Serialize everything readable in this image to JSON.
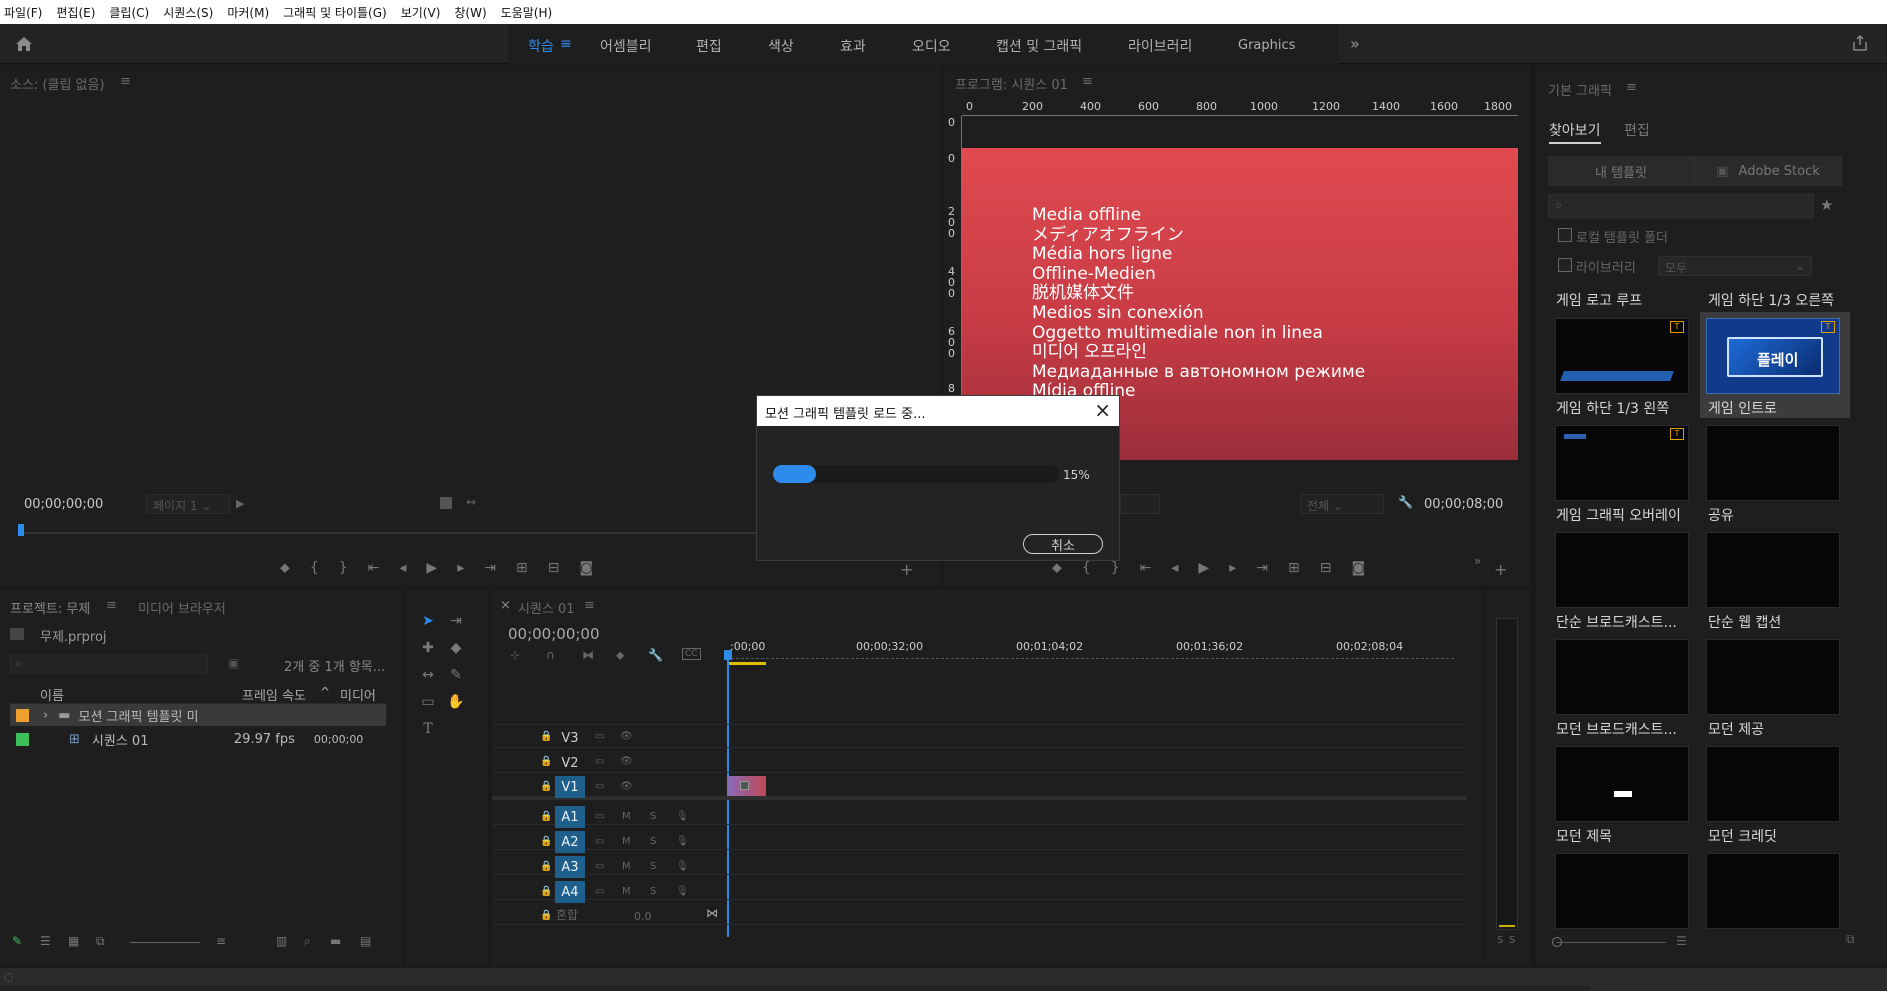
{
  "menu": [
    "파일(F)",
    "편집(E)",
    "클립(C)",
    "시퀀스(S)",
    "마커(M)",
    "그래픽 및 타이틀(G)",
    "보기(V)",
    "창(W)",
    "도움말(H)"
  ],
  "workspaces": {
    "tabs": [
      "학습",
      "어셈블리",
      "편집",
      "색상",
      "효과",
      "오디오",
      "캡션 및 그래픽",
      "라이브러리",
      "Graphics"
    ],
    "active": "학습",
    "more": "»"
  },
  "source_monitor": {
    "title": "소스: (클립 없음)",
    "menu_glyph": "≡",
    "timecode": "00;00;00;00",
    "page": "페이지 1"
  },
  "program_monitor": {
    "title": "프로그램: 시퀀스 01",
    "menu_glyph": "≡",
    "fit": "전체",
    "timecode": "00;00;08;00",
    "ruler_labels": [
      "0",
      "200",
      "400",
      "600",
      "800",
      "1000",
      "1200",
      "1400",
      "1600",
      "1800"
    ],
    "vruler_labels": [
      "0",
      "0",
      "2 0 0",
      "4 0 0",
      "6 0 0",
      "8"
    ],
    "offline_lines": [
      "Media offline",
      "メディアオフライン",
      "Média hors ligne",
      "Offline-Medien",
      "脱机媒体文件",
      "Medios sin conexión",
      "Oggetto multimediale non in linea",
      "미디어 오프라인",
      "Медиаданные в автономном режиме",
      "Mídia offline"
    ]
  },
  "essential_graphics": {
    "title": "기본 그래픽",
    "menu_glyph": "≡",
    "tabs": [
      "찾아보기",
      "편집"
    ],
    "active_tab": "찾아보기",
    "my_templates": "내 템플릿",
    "adobe_stock": "Adobe Stock",
    "local_folder": "로컬 템플릿 폴더",
    "libraries": "라이브러리",
    "library_select": "모두",
    "templates": [
      {
        "label": "게임 로고 루프",
        "thumb_label": "게임 하단 1/3 왼쪽"
      },
      {
        "label": "게임 하단 1/3 오른쪽",
        "thumb_label": "게임 인트로"
      },
      {
        "label": "",
        "thumb_label": "게임 그래픽 오버레이"
      },
      {
        "label": "",
        "thumb_label": "공유"
      },
      {
        "label": "",
        "thumb_label": "단순 브로드캐스트..."
      },
      {
        "label": "",
        "thumb_label": "단순 웹 캡션"
      },
      {
        "label": "",
        "thumb_label": "모던 브로드캐스트..."
      },
      {
        "label": "",
        "thumb_label": "모던 제공"
      },
      {
        "label": "",
        "thumb_label": "모던 제목"
      },
      {
        "label": "",
        "thumb_label": "모던 크레딧"
      }
    ],
    "intro_thumb_text": "플레이"
  },
  "project": {
    "title": "프로젝트: 무제",
    "menu_glyph": "≡",
    "media_browser": "미디어 브라우저",
    "file": "무제.prproj",
    "count": "2개 중 1개 항목...",
    "columns": [
      "이름",
      "프레임 속도",
      "미디어"
    ],
    "rows": [
      {
        "name": "모션 그래픽 템플릿 미",
        "fps": "",
        "media": ""
      },
      {
        "name": "시퀀스 01",
        "fps": "29.97 fps",
        "media": "00;00;00"
      }
    ]
  },
  "timeline": {
    "title": "시퀀스 01",
    "menu_glyph": "≡",
    "timecode": "00;00;00;00",
    "ruler": [
      ":00;00",
      "00;00;32;00",
      "00;01;04;02",
      "00;01;36;02",
      "00;02;08;04"
    ],
    "video_tracks": [
      "V3",
      "V2",
      "V1"
    ],
    "audio_tracks": [
      "A1",
      "A2",
      "A3",
      "A4"
    ],
    "mix": "혼합",
    "mix_value": "0.0",
    "mute": "M",
    "solo": "S"
  },
  "dialog": {
    "title": "모션 그래픽 템플릿 로드 중...",
    "progress": 0.15,
    "progress_label": "15%",
    "cancel": "취소"
  },
  "colors": {
    "accent": "#2d8ceb",
    "offline_red": "#e04a50",
    "orange": "#f0a030",
    "green": "#3fbf5a"
  }
}
